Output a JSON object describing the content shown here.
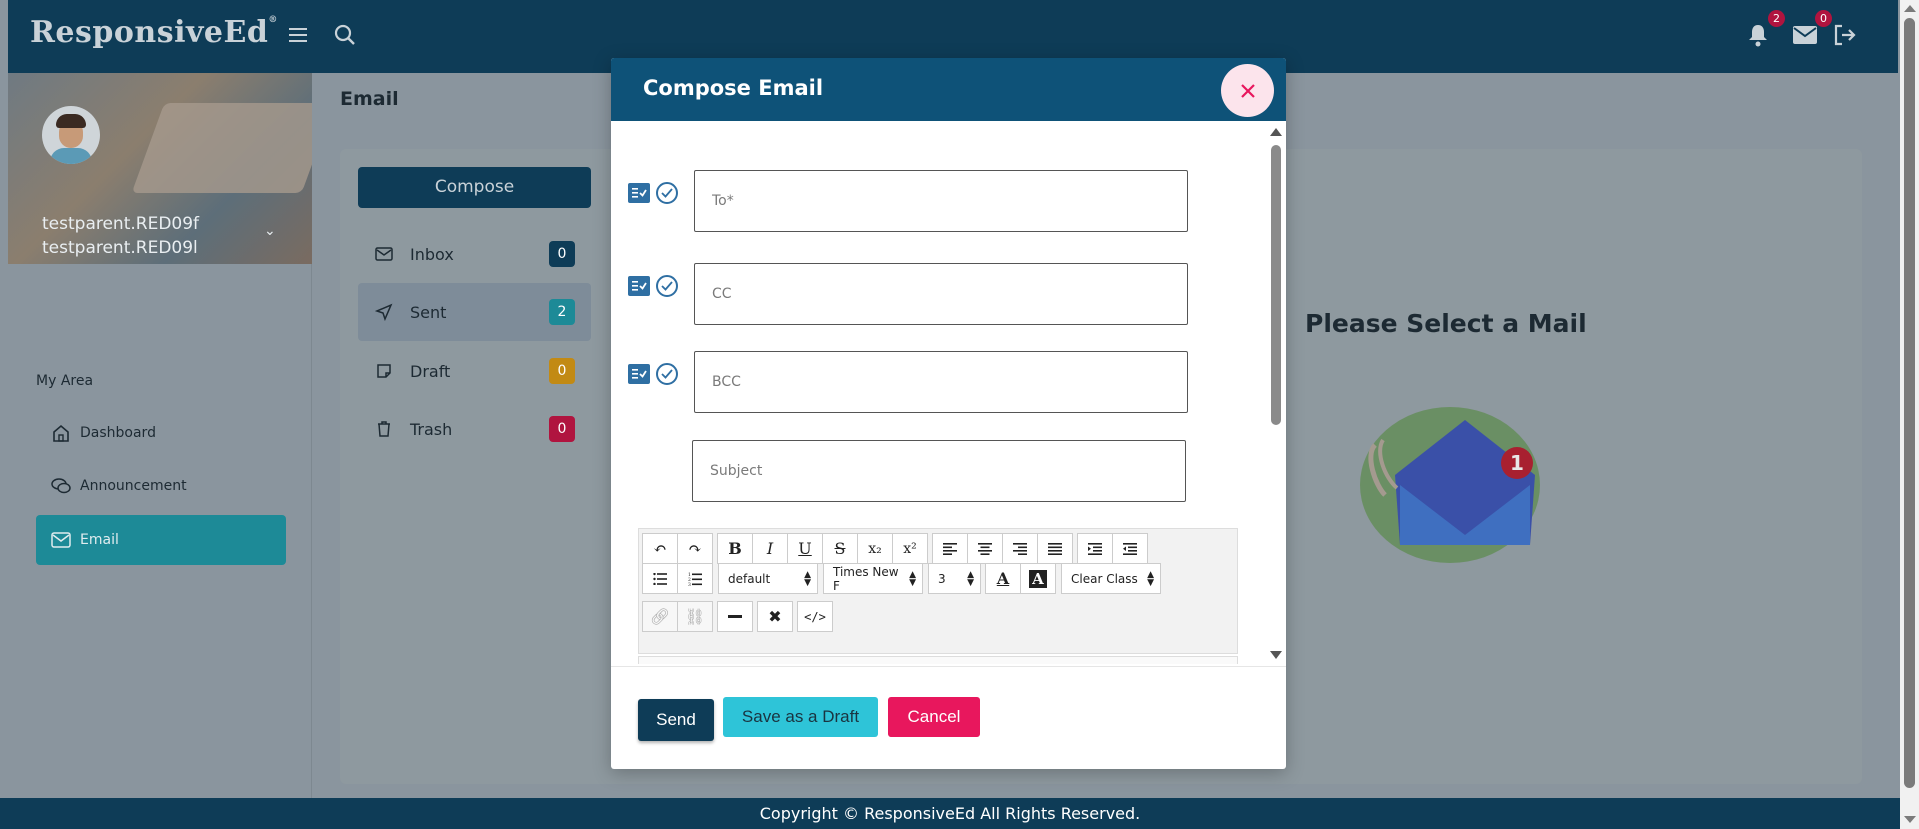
{
  "app": {
    "logo": "ResponsiveEd",
    "logo_mark": "®"
  },
  "header": {
    "notifications_count": "2",
    "messages_count": "0",
    "icons": [
      "menu-icon",
      "search-icon",
      "bell-icon",
      "envelope-icon",
      "logout-icon"
    ]
  },
  "profile": {
    "name_line1": "testparent.RED09f",
    "name_line2": "testparent.RED09l"
  },
  "sidebar": {
    "section": "My Area",
    "items": [
      {
        "label": "Dashboard",
        "icon": "home-icon"
      },
      {
        "label": "Announcement",
        "icon": "chat-icon"
      },
      {
        "label": "Email",
        "icon": "envelope-icon",
        "active": true
      }
    ]
  },
  "page": {
    "title": "Email"
  },
  "mailbox": {
    "compose_label": "Compose",
    "folders": [
      {
        "label": "Inbox",
        "count": "0",
        "color": "#0e3c57"
      },
      {
        "label": "Sent",
        "count": "2",
        "color": "#1d8a97"
      },
      {
        "label": "Draft",
        "count": "0",
        "color": "#c28a14"
      },
      {
        "label": "Trash",
        "count": "0",
        "color": "#b0143f"
      }
    ],
    "empty_message": "Please Select a Mail",
    "illustration_badge": "1"
  },
  "modal": {
    "title": "Compose Email",
    "to_placeholder": "To*",
    "cc_placeholder": "CC",
    "bcc_placeholder": "BCC",
    "subject_placeholder": "Subject",
    "toolbar": {
      "style_select": "default",
      "font_select": "Times New F",
      "size_select": "3",
      "class_select": "Clear Class"
    },
    "send_label": "Send",
    "draft_label": "Save as a Draft",
    "cancel_label": "Cancel"
  },
  "footer": {
    "text": "Copyright © ResponsiveEd All Rights Reserved."
  },
  "colors": {
    "primary": "#0e3c57",
    "accent": "#2ec4d8",
    "danger": "#e8175d",
    "modal_header": "#0e5278"
  }
}
